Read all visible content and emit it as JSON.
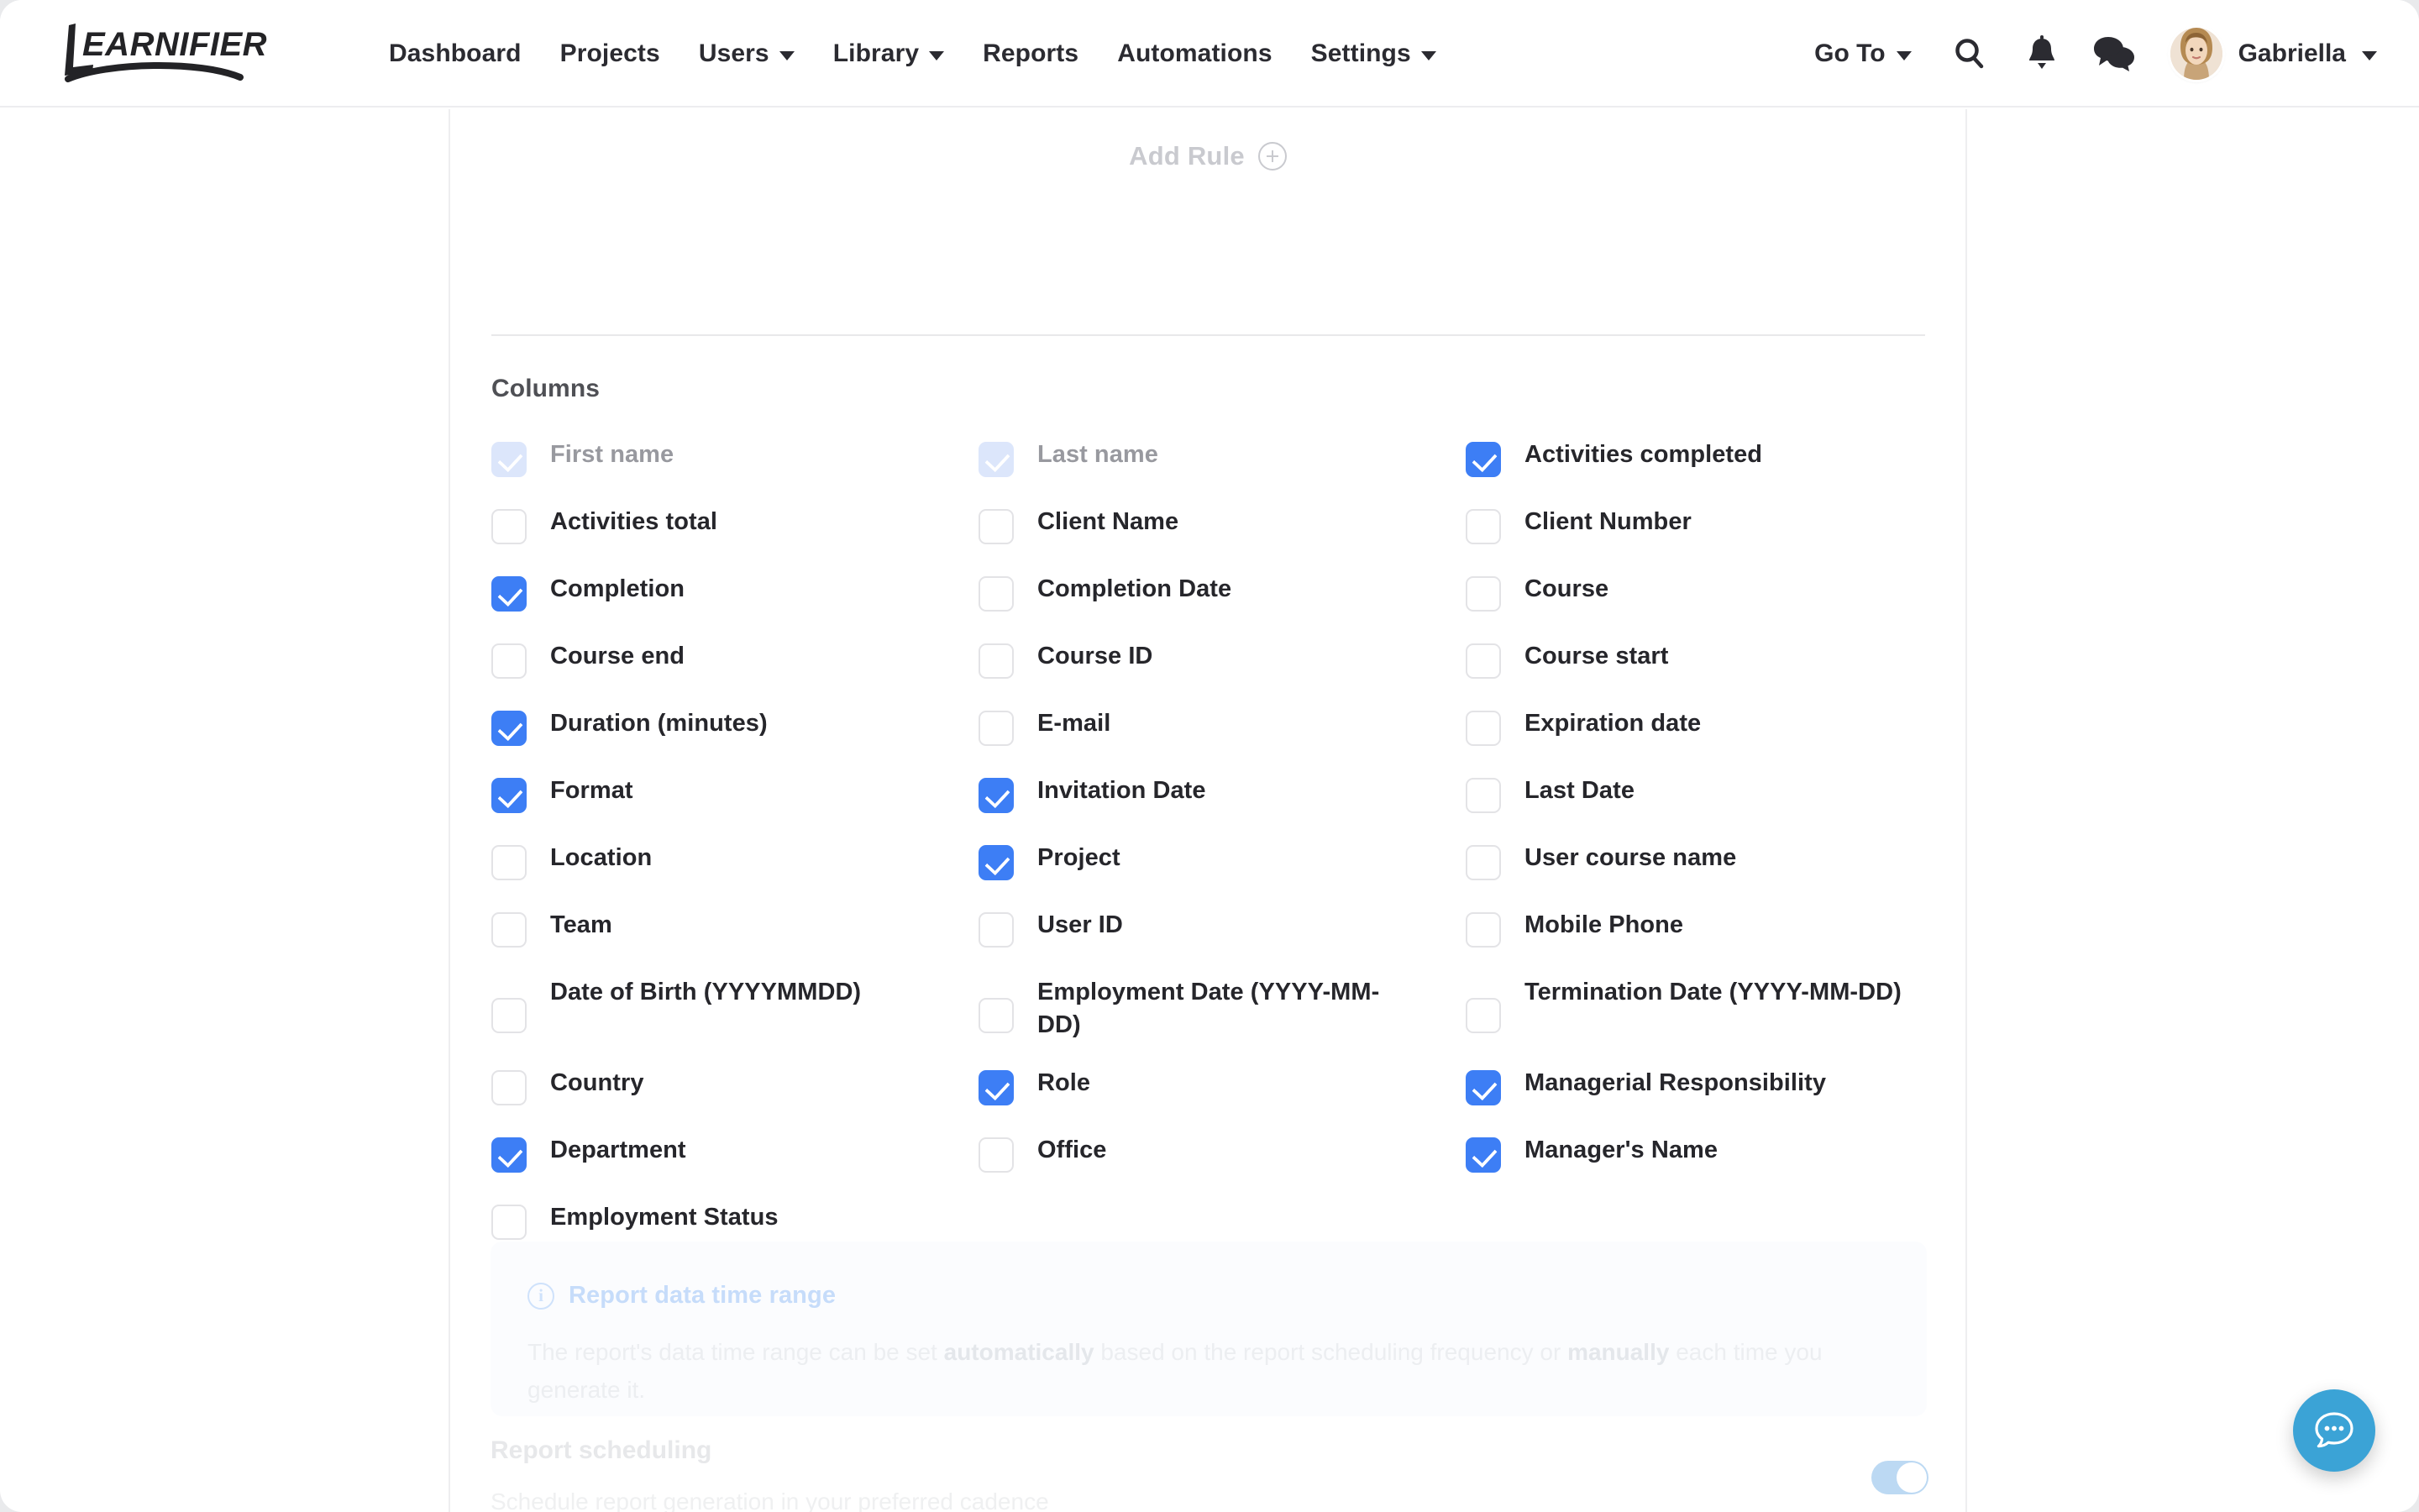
{
  "app": {
    "brand": "LEARNIFIER"
  },
  "header": {
    "nav": [
      {
        "label": "Dashboard",
        "has_caret": false,
        "icon": ""
      },
      {
        "label": "Projects",
        "has_caret": false,
        "icon": ""
      },
      {
        "label": "Users",
        "has_caret": true,
        "icon": "chevron-down-icon"
      },
      {
        "label": "Library",
        "has_caret": true,
        "icon": "chevron-down-icon"
      },
      {
        "label": "Reports",
        "has_caret": false,
        "icon": ""
      },
      {
        "label": "Automations",
        "has_caret": false,
        "icon": ""
      },
      {
        "label": "Settings",
        "has_caret": true,
        "icon": "chevron-down-icon"
      }
    ],
    "goto_label": "Go To",
    "icons": {
      "search": "search-icon",
      "notifications": "bell-icon",
      "messages": "chat-bubbles-icon",
      "avatar": "avatar"
    },
    "user_name": "Gabriella"
  },
  "rules": {
    "add_rule_label": "Add Rule",
    "add_rule_icon": "plus-circle-icon"
  },
  "columns_section": {
    "title": "Columns",
    "items": [
      {
        "label": "First name",
        "state": "locked"
      },
      {
        "label": "Last name",
        "state": "locked"
      },
      {
        "label": "Activities completed",
        "state": "checked"
      },
      {
        "label": "Activities total",
        "state": "unchecked"
      },
      {
        "label": "Client Name",
        "state": "unchecked"
      },
      {
        "label": "Client Number",
        "state": "unchecked"
      },
      {
        "label": "Completion",
        "state": "checked"
      },
      {
        "label": "Completion Date",
        "state": "unchecked"
      },
      {
        "label": "Course",
        "state": "unchecked"
      },
      {
        "label": "Course end",
        "state": "unchecked"
      },
      {
        "label": "Course ID",
        "state": "unchecked"
      },
      {
        "label": "Course start",
        "state": "unchecked"
      },
      {
        "label": "Duration (minutes)",
        "state": "checked"
      },
      {
        "label": "E-mail",
        "state": "unchecked"
      },
      {
        "label": "Expiration date",
        "state": "unchecked"
      },
      {
        "label": "Format",
        "state": "checked"
      },
      {
        "label": "Invitation Date",
        "state": "checked"
      },
      {
        "label": "Last Date",
        "state": "unchecked"
      },
      {
        "label": "Location",
        "state": "unchecked"
      },
      {
        "label": "Project",
        "state": "checked"
      },
      {
        "label": "User course name",
        "state": "unchecked"
      },
      {
        "label": "Team",
        "state": "unchecked"
      },
      {
        "label": "User ID",
        "state": "unchecked"
      },
      {
        "label": "Mobile Phone",
        "state": "unchecked"
      },
      {
        "label": "Date of Birth (YYYYMMDD)",
        "state": "unchecked",
        "tall": true
      },
      {
        "label": "Employment Date (YYYY-MM-DD)",
        "state": "unchecked",
        "tall": true
      },
      {
        "label": "Termination Date (YYYY-MM-DD)",
        "state": "unchecked",
        "tall": true
      },
      {
        "label": "Country",
        "state": "unchecked"
      },
      {
        "label": "Role",
        "state": "checked"
      },
      {
        "label": "Managerial Responsibility",
        "state": "checked"
      },
      {
        "label": "Department",
        "state": "checked"
      },
      {
        "label": "Office",
        "state": "unchecked"
      },
      {
        "label": "Manager's Name",
        "state": "checked"
      },
      {
        "label": "Employment Status",
        "state": "unchecked"
      },
      {
        "label": "",
        "state": "none"
      },
      {
        "label": "",
        "state": "none"
      }
    ]
  },
  "info_box": {
    "icon": "info-circle-icon",
    "title": "Report data time range",
    "body_part_1": "The report's data time range can be set ",
    "body_bold_1": "automatically",
    "body_part_2": " based on the report scheduling frequency or ",
    "body_bold_2": "manually",
    "body_part_3": " each time you generate it."
  },
  "report_scheduling": {
    "title": "Report scheduling",
    "subtitle": "Schedule report generation in your preferred cadence",
    "toggle_state": "on"
  },
  "support": {
    "fab_icon": "chat-bubble-icon"
  },
  "colors": {
    "accent_blue": "#3d7ef5",
    "locked_blue": "#dce6fb",
    "fab_blue": "#3ba3d6",
    "toggle_blue": "#bcd9f3",
    "text_dark": "#26262b",
    "text_muted": "#98999f"
  }
}
